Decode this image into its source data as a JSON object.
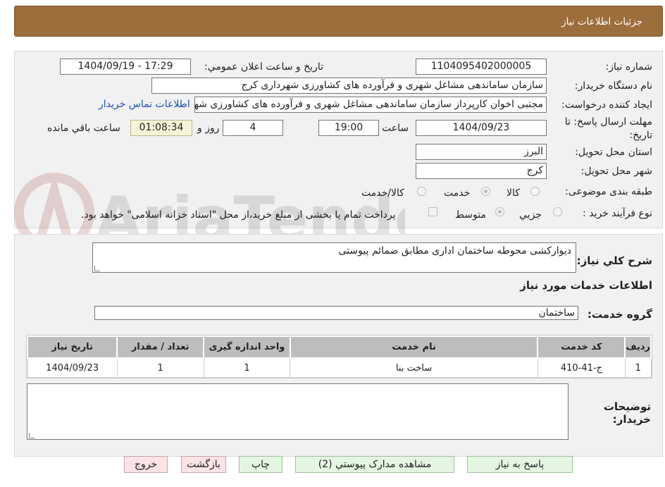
{
  "header": {
    "title": "جزئیات اطلاعات نیاز"
  },
  "watermark_text": "AriaTender.neT",
  "form": {
    "need_number": {
      "label": "شماره نیاز:",
      "value": "1104095402000005"
    },
    "announce": {
      "label": "تاریخ و ساعت اعلان عمومي:",
      "value": "1404/09/19 - 17:29"
    },
    "buyer": {
      "label": "نام دستگاه خریدار:",
      "value": "سازمان ساماندهی مشاغل شهری و فرآورده های کشاورزی شهرداری کرج"
    },
    "creator": {
      "label": "ایجاد کننده درخواست:",
      "value": "مجتبی اخوان کارپرداز سازمان ساماندهی مشاغل شهری و فرآورده های کشاورزی شهرداری کرج",
      "contact_link": "اطلاعات تماس خریدار"
    },
    "deadline": {
      "label": "مهلت ارسال پاسخ: تا تاریخ:",
      "date": "1404/09/23",
      "time_label": "ساعت",
      "time": "19:00",
      "days": "4",
      "days_label": "روز و",
      "remaining": "01:08:34",
      "remaining_label": "ساعت باقي مانده"
    },
    "province": {
      "label": "استان محل تحویل:",
      "value": "البرز"
    },
    "city": {
      "label": "شهر محل تحویل:",
      "value": "کرج"
    },
    "category": {
      "label": "طبقه بندی موضوعی:",
      "options": [
        "کالا",
        "خدمت",
        "کالا/خدمت"
      ],
      "selected": "خدمت"
    },
    "process": {
      "label": "نوع فرآیند خرید :",
      "options": [
        "جزيي",
        "متوسط"
      ],
      "selected": "متوسط",
      "payment_note": "پرداخت تمام یا بخشی از مبلغ خرید،از محل \"اسناد خزانه اسلامی\" خواهد بود."
    }
  },
  "summary": {
    "label": "شرح کلي نیاز:",
    "value": "دیوارکشی محوطه ساختمان اداری مطابق ضمائم پیوستی"
  },
  "services": {
    "section_title": "اطلاعات خدمات مورد نیاز",
    "group_label": "گروه خدمت:",
    "group_value": "ساختمان",
    "columns": [
      "ردیف",
      "کد خدمت",
      "نام خدمت",
      "واحد اندازه گیری",
      "تعداد / مقدار",
      "تاریخ نیاز"
    ],
    "rows": [
      [
        "1",
        "ج-41-410",
        "ساخت بنا",
        "1",
        "1",
        "1404/09/23"
      ]
    ]
  },
  "buyer_notes": {
    "label": "توضیحات خریدار:",
    "value": ""
  },
  "buttons": {
    "reply": "پاسخ به نیاز",
    "docs": "مشاهده مدارک پیوستي (2)",
    "print": "چاپ",
    "back": "بازگشت",
    "exit": "خروج"
  },
  "colors": {
    "header_bg": "#9c6e3c",
    "button_green": "#e4f6e2",
    "button_pink": "#fbe3e6",
    "timer_bg": "#f8f3d6",
    "link": "#1a4fb8"
  }
}
